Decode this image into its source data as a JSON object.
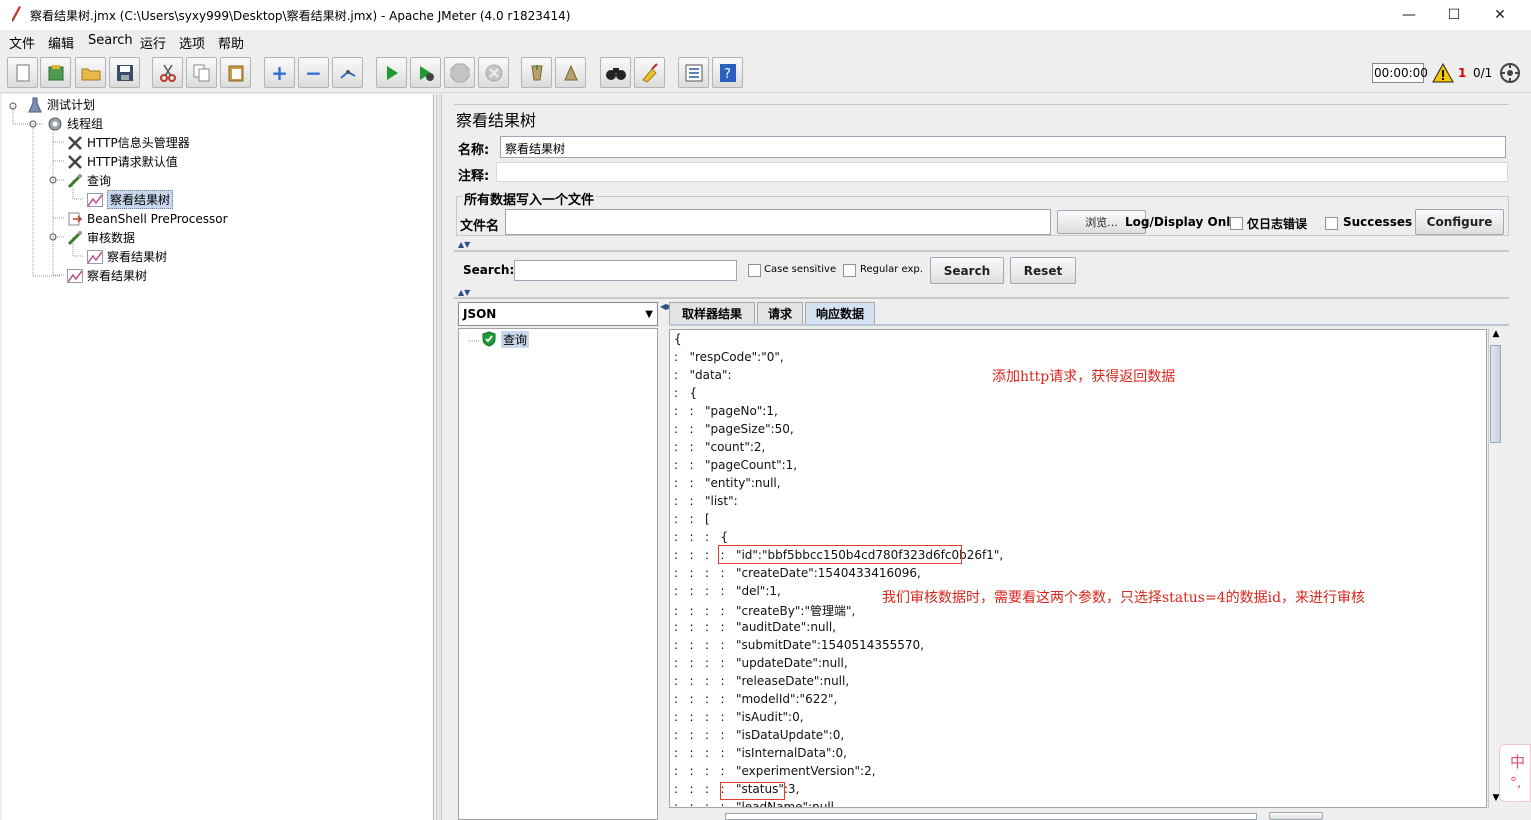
{
  "window": {
    "title": "察看结果树.jmx (C:\\Users\\syxy999\\Desktop\\察看结果树.jmx) - Apache JMeter (4.0 r1823414)",
    "minimize": "—",
    "maximize": "☐",
    "close": "✕"
  },
  "menu": [
    "文件",
    "编辑",
    "Search",
    "运行",
    "选项",
    "帮助"
  ],
  "toolbar": {
    "timer": "00:00:00",
    "warn_count": "1",
    "threads": "0/1",
    "icons": [
      "new-icon",
      "templates-icon",
      "open-icon",
      "save-icon",
      "cut-icon",
      "copy-icon",
      "paste-icon",
      "expand-icon",
      "collapse-icon",
      "toggle-icon",
      "start-icon",
      "start-no-pause-icon",
      "stop-icon",
      "shutdown-icon",
      "clear-icon",
      "clear-all-icon",
      "search-icon",
      "reset-search-icon",
      "function-helper-icon",
      "help-icon"
    ]
  },
  "tree": {
    "items": [
      {
        "label": "测试计划",
        "icon": "test-plan-icon"
      },
      {
        "label": "线程组",
        "icon": "thread-group-icon"
      },
      {
        "label": "HTTP信息头管理器",
        "icon": "config-icon"
      },
      {
        "label": "HTTP请求默认值",
        "icon": "config-icon"
      },
      {
        "label": "查询",
        "icon": "sampler-icon"
      },
      {
        "label": "察看结果树",
        "icon": "listener-icon"
      },
      {
        "label": "BeanShell PreProcessor",
        "icon": "preprocessor-icon"
      },
      {
        "label": "审核数据",
        "icon": "sampler-icon"
      },
      {
        "label": "察看结果树",
        "icon": "listener-icon"
      },
      {
        "label": "察看结果树",
        "icon": "listener-icon"
      }
    ]
  },
  "panel": {
    "title": "察看结果树",
    "name_label": "名称:",
    "name_value": "察看结果树",
    "comment_label": "注释:",
    "comment_value": "",
    "file_group_title": "所有数据写入一个文件",
    "file_label": "文件名",
    "file_value": "",
    "browse_label": "浏览...",
    "log_display_label": "Log/Display Only:",
    "errors_label": "仅日志错误",
    "successes_label": "Successes",
    "configure_label": "Configure",
    "search_label": "Search:",
    "search_value": "",
    "case_sensitive_label": "Case sensitive",
    "regex_label": "Regular exp.",
    "search_button": "Search",
    "reset_button": "Reset",
    "renderer_value": "JSON",
    "result_item": "查询",
    "tabs": [
      "取样器结果",
      "请求",
      "响应数据"
    ],
    "active_tab": "响应数据"
  },
  "response_lines": [
    "{",
    ":   \"respCode\":\"0\",",
    ":   \"data\":",
    ":   {",
    ":   :   \"pageNo\":1,",
    ":   :   \"pageSize\":50,",
    ":   :   \"count\":2,",
    ":   :   \"pageCount\":1,",
    ":   :   \"entity\":null,",
    ":   :   \"list\":",
    ":   :   [",
    ":   :   :   {",
    ":   :   :   :   \"id\":\"bbf5bbcc150b4cd780f323d6fc0b26f1\",",
    ":   :   :   :   \"createDate\":1540433416096,",
    ":   :   :   :   \"del\":1,",
    ":   :   :   :   \"createBy\":\"管理端\",",
    ":   :   :   :   \"auditDate\":null,",
    ":   :   :   :   \"submitDate\":1540514355570,",
    ":   :   :   :   \"updateDate\":null,",
    ":   :   :   :   \"releaseDate\":null,",
    ":   :   :   :   \"modelId\":\"622\",",
    ":   :   :   :   \"isAudit\":0,",
    ":   :   :   :   \"isDataUpdate\":0,",
    ":   :   :   :   \"isInternalData\":0,",
    ":   :   :   :   \"experimentVersion\":2,",
    ":   :   :   :   \"status\":3,",
    ":   :   :   :   \"leadName\":null,"
  ],
  "annotations": {
    "note1": "添加http请求，获得返回数据",
    "note2": "我们审核数据时，需要看这两个参数，只选择status=4的数据id，来进行审核"
  },
  "ime": {
    "char1": "中",
    "char2": "°,"
  },
  "colors": {
    "annotation": "#d9261c",
    "selection": "#c8d7eb"
  }
}
